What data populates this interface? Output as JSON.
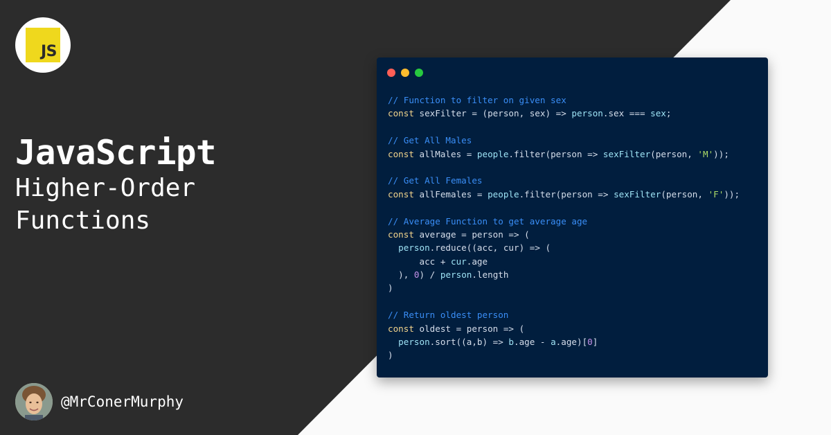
{
  "logo": {
    "text": "JS"
  },
  "title": "JavaScript",
  "subtitle": [
    "Higher-Order",
    "Functions"
  ],
  "author": {
    "handle": "@MrConerMurphy"
  },
  "window": {
    "dots": [
      "#ff5f56",
      "#ffbd2e",
      "#27c93f"
    ]
  },
  "colors": {
    "comment": "#3a8ef6",
    "keyword": "#f3d48c",
    "plain": "#d6deeb",
    "identifier": "#9fe3f5",
    "string": "#addb67",
    "number": "#c792ea"
  },
  "code_lines": [
    [
      [
        "comment",
        "// Function to filter on given sex"
      ]
    ],
    [
      [
        "keyword",
        "const"
      ],
      [
        "plain",
        " sexFilter = (person, sex) => "
      ],
      [
        "ident",
        "person"
      ],
      [
        "plain",
        ".sex === "
      ],
      [
        "ident",
        "sex"
      ],
      [
        "plain",
        ";"
      ]
    ],
    [],
    [
      [
        "comment",
        "// Get All Males"
      ]
    ],
    [
      [
        "keyword",
        "const"
      ],
      [
        "plain",
        " allMales = "
      ],
      [
        "ident",
        "people"
      ],
      [
        "plain",
        ".filter(person => "
      ],
      [
        "ident",
        "sexFilter"
      ],
      [
        "plain",
        "(person, "
      ],
      [
        "string",
        "'M'"
      ],
      [
        "plain",
        "));"
      ]
    ],
    [],
    [
      [
        "comment",
        "// Get All Females"
      ]
    ],
    [
      [
        "keyword",
        "const"
      ],
      [
        "plain",
        " allFemales = "
      ],
      [
        "ident",
        "people"
      ],
      [
        "plain",
        ".filter(person => "
      ],
      [
        "ident",
        "sexFilter"
      ],
      [
        "plain",
        "(person, "
      ],
      [
        "string",
        "'F'"
      ],
      [
        "plain",
        "));"
      ]
    ],
    [],
    [
      [
        "comment",
        "// Average Function to get average age"
      ]
    ],
    [
      [
        "keyword",
        "const"
      ],
      [
        "plain",
        " average = person => ("
      ]
    ],
    [
      [
        "plain",
        "  "
      ],
      [
        "ident",
        "person"
      ],
      [
        "plain",
        ".reduce((acc, cur) => ("
      ]
    ],
    [
      [
        "plain",
        "      acc + "
      ],
      [
        "ident",
        "cur"
      ],
      [
        "plain",
        ".age"
      ]
    ],
    [
      [
        "plain",
        "  ), "
      ],
      [
        "number",
        "0"
      ],
      [
        "plain",
        ") / "
      ],
      [
        "ident",
        "person"
      ],
      [
        "plain",
        ".length"
      ]
    ],
    [
      [
        "plain",
        ")"
      ]
    ],
    [],
    [
      [
        "comment",
        "// Return oldest person"
      ]
    ],
    [
      [
        "keyword",
        "const"
      ],
      [
        "plain",
        " oldest = person => ("
      ]
    ],
    [
      [
        "plain",
        "  "
      ],
      [
        "ident",
        "person"
      ],
      [
        "plain",
        ".sort((a,b) => "
      ],
      [
        "ident",
        "b"
      ],
      [
        "plain",
        ".age - "
      ],
      [
        "ident",
        "a"
      ],
      [
        "plain",
        ".age)["
      ],
      [
        "number",
        "0"
      ],
      [
        "plain",
        "]"
      ]
    ],
    [
      [
        "plain",
        ")"
      ]
    ]
  ]
}
